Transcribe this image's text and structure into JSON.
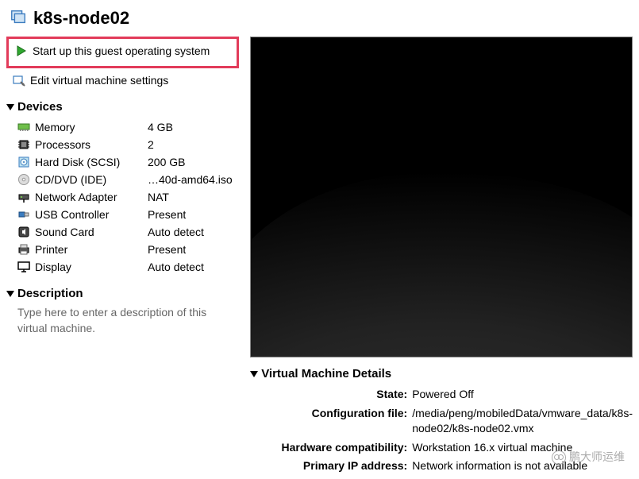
{
  "header": {
    "title": "k8s-node02"
  },
  "actions": {
    "start": "Start up this guest operating system",
    "edit": "Edit virtual machine settings"
  },
  "sections": {
    "devices_title": "Devices",
    "description_title": "Description",
    "details_title": "Virtual Machine Details"
  },
  "devices": [
    {
      "icon": "memory-icon",
      "name": "Memory",
      "value": "4 GB"
    },
    {
      "icon": "cpu-icon",
      "name": "Processors",
      "value": "2"
    },
    {
      "icon": "disk-icon",
      "name": "Hard Disk (SCSI)",
      "value": "200 GB"
    },
    {
      "icon": "cd-icon",
      "name": "CD/DVD (IDE)",
      "value": "…40d-amd64.iso"
    },
    {
      "icon": "network-icon",
      "name": "Network Adapter",
      "value": "NAT"
    },
    {
      "icon": "usb-icon",
      "name": "USB Controller",
      "value": "Present"
    },
    {
      "icon": "sound-icon",
      "name": "Sound Card",
      "value": "Auto detect"
    },
    {
      "icon": "printer-icon",
      "name": "Printer",
      "value": "Present"
    },
    {
      "icon": "display-icon",
      "name": "Display",
      "value": "Auto detect"
    }
  ],
  "description_placeholder": "Type here to enter a description of this virtual machine.",
  "details": [
    {
      "label": "State:",
      "value": "Powered Off"
    },
    {
      "label": "Configuration file:",
      "value": "/media/peng/mobiledData/vmware_data/k8s-node02/k8s-node02.vmx"
    },
    {
      "label": "Hardware compatibility:",
      "value": "Workstation 16.x virtual machine"
    },
    {
      "label": "Primary IP address:",
      "value": "Network information is not available"
    }
  ],
  "watermark": "鹏大师运维"
}
